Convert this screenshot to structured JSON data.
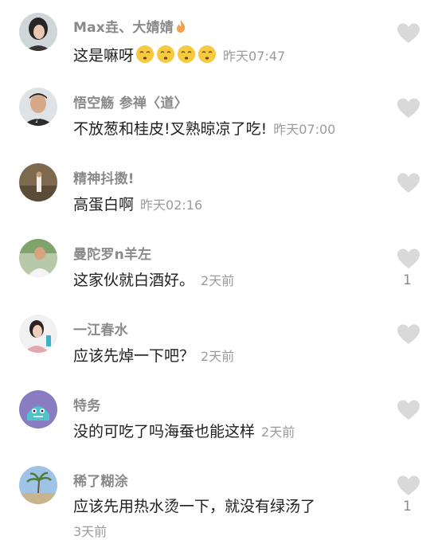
{
  "comments": [
    {
      "name": "Max垚、大婧婧",
      "text": "这是嘛呀",
      "time": "昨天07:47",
      "likes": "",
      "avatar_icon": "woman-portrait-avatar"
    },
    {
      "name": "悟空觞 参禅〈道〉",
      "text": "不放葱和桂皮!叉熟晾凉了吃!",
      "time": "昨天07:00",
      "likes": "",
      "avatar_icon": "man-portrait-avatar"
    },
    {
      "name": "精神抖擞!",
      "text": "高蛋白啊",
      "time": "昨天02:16",
      "likes": "",
      "avatar_icon": "outdoor-person-avatar"
    },
    {
      "name": "曼陀罗n羊左",
      "text": "这家伙就白酒好。",
      "time": "2天前",
      "likes": "1",
      "avatar_icon": "man-portrait-avatar"
    },
    {
      "name": "一江春水",
      "text": "应该先焯一下吧？",
      "time": "2天前",
      "likes": "",
      "avatar_icon": "woman-portrait-avatar"
    },
    {
      "name": "特务",
      "text": "没的可吃了吗海蚕也能这样",
      "time": "2天前",
      "likes": "",
      "avatar_icon": "cartoon-character-avatar"
    },
    {
      "name": "稀了糊涂",
      "text": "应该先用热水烫一下，就没有绿汤了",
      "time": "3天前",
      "likes": "1",
      "avatar_icon": "palm-tree-avatar"
    }
  ],
  "colors": {
    "name": "#8a8a8a",
    "text": "#1f1f1f",
    "time": "#9b9b9b",
    "heart": "#d9d9d9"
  }
}
